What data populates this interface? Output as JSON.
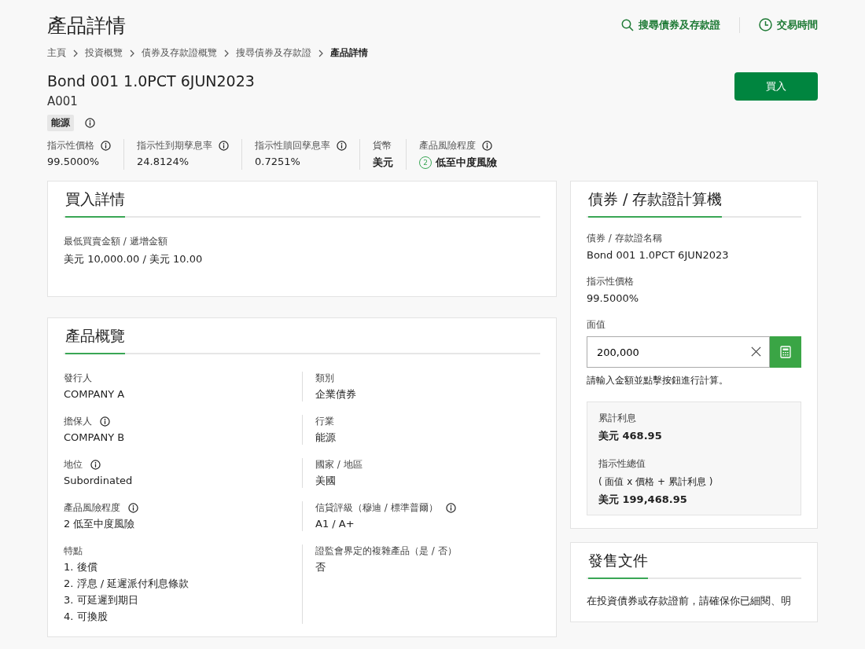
{
  "page_title": "產品詳情",
  "header_links": [
    {
      "kind": "search",
      "label": "搜尋債券及存款證"
    },
    {
      "kind": "clock",
      "label": "交易時間"
    }
  ],
  "breadcrumb": [
    {
      "label": "主頁",
      "selected": false
    },
    {
      "label": "投資概覽",
      "selected": false
    },
    {
      "label": "債券及存款證概覽",
      "selected": false
    },
    {
      "label": "搜尋債券及存款證",
      "selected": false
    },
    {
      "label": "產品詳情",
      "selected": true
    }
  ],
  "product": {
    "name": "Bond 001 1.0PCT 6JUN2023",
    "code": "A001",
    "tag": "能源",
    "buy_button": "買入"
  },
  "stats": [
    {
      "label": "指示性價格",
      "info": true,
      "value": "99.5000%"
    },
    {
      "label": "指示性到期孳息率",
      "info": true,
      "value": "24.8124%"
    },
    {
      "label": "指示性贖回孳息率",
      "info": true,
      "value": "0.7251%"
    },
    {
      "label": "貨幣",
      "info": false,
      "value": "美元"
    },
    {
      "label": "產品風險程度",
      "info": true,
      "value": "低至中度風險",
      "risk_level": "2"
    }
  ],
  "purchase_details": {
    "title": "買入詳情",
    "label": "最低買賣金額 / 遞增金額",
    "value": "美元 10,000.00 / 美元 10.00"
  },
  "overview": {
    "title": "產品概覽",
    "fields": [
      {
        "label": "發行人",
        "info": false,
        "values": [
          "COMPANY A"
        ]
      },
      {
        "label": "類別",
        "info": false,
        "values": [
          "企業債券"
        ]
      },
      {
        "label": "擔保人",
        "info": true,
        "values": [
          "COMPANY B"
        ]
      },
      {
        "label": "行業",
        "info": false,
        "values": [
          "能源"
        ]
      },
      {
        "label": "地位",
        "info": true,
        "values": [
          "Subordinated"
        ]
      },
      {
        "label": "國家 / 地區",
        "info": false,
        "values": [
          "美國"
        ]
      },
      {
        "label": "產品風險程度",
        "info": true,
        "values": [
          "2 低至中度風險"
        ]
      },
      {
        "label": "信貸評級（穆迪 / 標準普爾）",
        "info": true,
        "values": [
          "A1 / A+"
        ]
      },
      {
        "label": "特點",
        "info": false,
        "values": [
          "1. 後償",
          "2. 浮息 / 延遲派付利息條款",
          "3. 可延遲到期日",
          "4. 可換股"
        ]
      },
      {
        "label": "證監會界定的複雜產品（是 / 否）",
        "info": false,
        "values": [
          "否"
        ]
      }
    ]
  },
  "calculator": {
    "title": "債券 / 存款證計算機",
    "name_label": "債券 / 存款證名稱",
    "name_value": "Bond 001 1.0PCT 6JUN2023",
    "price_label": "指示性價格",
    "price_value": "99.5000%",
    "face_label": "面值",
    "face_value": "200,000",
    "hint": "請輸入金額並點擊按鈕進行計算。",
    "results": [
      {
        "label": "累計利息",
        "value": "美元 468.95"
      },
      {
        "label": "指示性總值",
        "note": "( 面值 x 價格 + 累計利息 )",
        "value": "美元 199,468.95"
      }
    ]
  },
  "documents": {
    "title": "發售文件",
    "text": "在投資債券或存款證前，請確保你已細閱、明"
  }
}
